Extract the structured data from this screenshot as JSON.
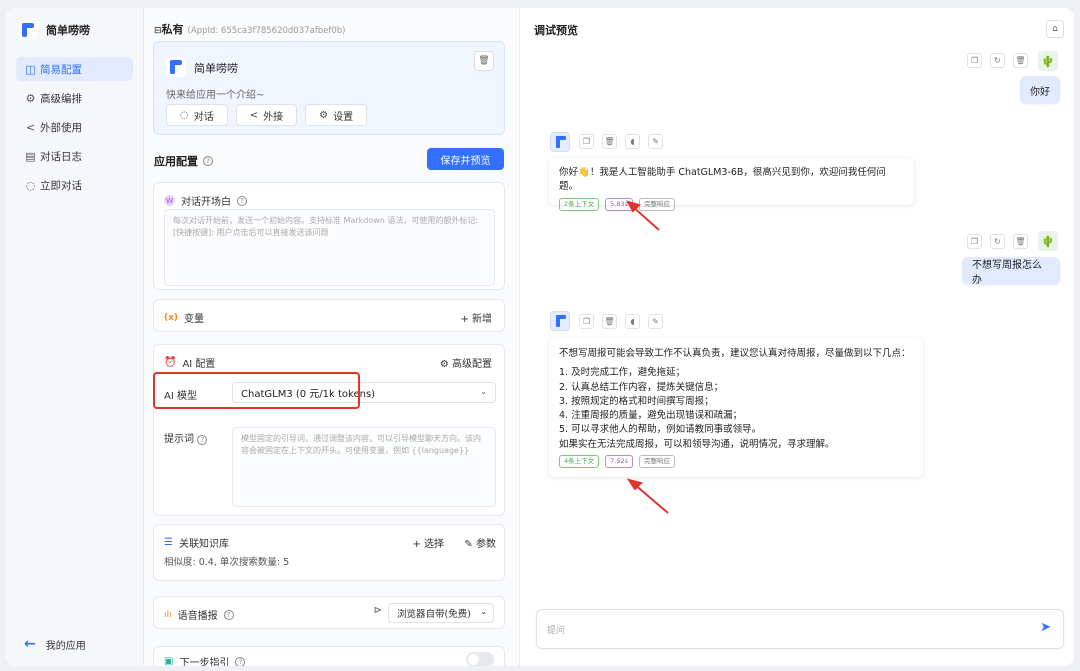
{
  "brand": {
    "name": "简单唠唠"
  },
  "sidebar": {
    "items": [
      {
        "label": "简易配置",
        "icon": "layout-icon"
      },
      {
        "label": "高级编排",
        "icon": "gear-icon"
      },
      {
        "label": "外部使用",
        "icon": "share-icon"
      },
      {
        "label": "对话日志",
        "icon": "log-icon"
      },
      {
        "label": "立即对话",
        "icon": "chat-icon"
      }
    ],
    "my_apps": "我的应用"
  },
  "config": {
    "private_title": "私有",
    "app_id": "(AppId: 655ca3f785620d037afbef0b)",
    "app_name": "简单唠唠",
    "app_intro": "快来给应用一个介绍~",
    "actions": [
      "对话",
      "外接",
      "设置"
    ],
    "section_title": "应用配置",
    "save_label": "保存并预览",
    "welcome": {
      "title": "对话开场白",
      "placeholder": "每次对话开始前，发送一个初始内容。支持标准 Markdown 语法，可使用的额外标记: [快捷按键]: 用户点击后可以直接发送该问题"
    },
    "variables": {
      "title": "变量",
      "add": "+ 新增"
    },
    "ai": {
      "title": "AI 配置",
      "advanced": "高级配置",
      "model_label": "AI 模型",
      "model_value": "ChatGLM3 (0 元/1k tokens)",
      "prompt_label": "提示词",
      "prompt_placeholder": "模型固定的引导词，通过调整该内容，可以引导模型聊天方向。该内容会被固定在上下文的开头。可使用变量，例如 {{language}}"
    },
    "kb": {
      "title": "关联知识库",
      "select": "+ 选择",
      "params": "参数",
      "sub": "相似度: 0.4, 单次搜索数量: 5"
    },
    "tts": {
      "title": "语音播报",
      "value": "浏览器自带(免费)"
    },
    "next": {
      "title": "下一步指引"
    }
  },
  "chat": {
    "title": "调试预览",
    "messages": [
      {
        "role": "user",
        "text": "你好"
      },
      {
        "role": "bot",
        "lines": [
          "你好👋！我是人工智能助手 ChatGLM3-6B，很高兴见到你，欢迎问我任何问题。"
        ],
        "tags": [
          "2条上下文",
          "5.83s",
          "完整响应"
        ]
      },
      {
        "role": "user",
        "text": "不想写周报怎么办"
      },
      {
        "role": "bot",
        "lines": [
          "不想写周报可能会导致工作不认真负责，建议您认真对待周报，尽量做到以下几点：",
          "1. 及时完成工作，避免拖延；",
          "2. 认真总结工作内容，提炼关键信息；",
          "3. 按照规定的格式和时间撰写周报；",
          "4. 注重周报的质量，避免出现错误和疏漏；",
          "5. 可以寻求他人的帮助，例如请教同事或领导。",
          "如果实在无法完成周报，可以和领导沟通，说明情况，寻求理解。"
        ],
        "tags": [
          "4条上下文",
          "7.52s",
          "完整响应"
        ]
      }
    ],
    "input_placeholder": "提问"
  },
  "colors": {
    "accent": "#3370ff",
    "highlight": "#e0352b"
  }
}
